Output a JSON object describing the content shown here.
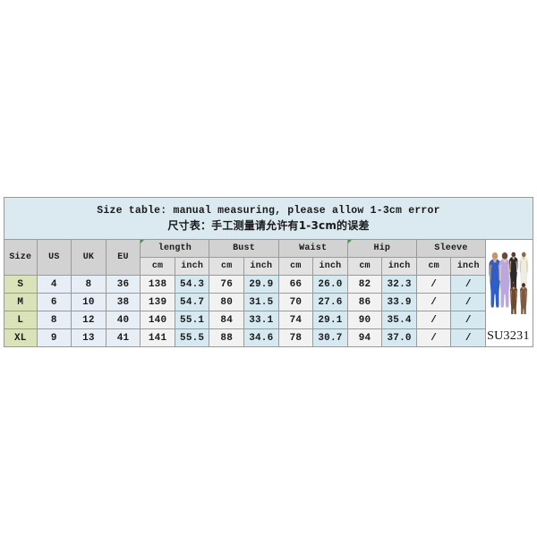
{
  "table": {
    "title_en": "Size table: manual measuring, please allow 1-3cm error",
    "title_cn": "尺寸表：手工测量请允许有1-3cm的误差",
    "base_headers": [
      "Size",
      "US",
      "UK",
      "EU"
    ],
    "measure_groups": [
      "length",
      "Bust",
      "Waist",
      "Hip",
      "Sleeve"
    ],
    "unit_headers": [
      "cm",
      "inch"
    ],
    "rows": [
      {
        "size": "S",
        "us": "4",
        "uk": "8",
        "eu": "36",
        "length_cm": "138",
        "length_inch": "54.3",
        "bust_cm": "76",
        "bust_inch": "29.9",
        "waist_cm": "66",
        "waist_inch": "26.0",
        "hip_cm": "82",
        "hip_inch": "32.3",
        "sleeve_cm": "/",
        "sleeve_inch": "/"
      },
      {
        "size": "M",
        "us": "6",
        "uk": "10",
        "eu": "38",
        "length_cm": "139",
        "length_inch": "54.7",
        "bust_cm": "80",
        "bust_inch": "31.5",
        "waist_cm": "70",
        "waist_inch": "27.6",
        "hip_cm": "86",
        "hip_inch": "33.9",
        "sleeve_cm": "/",
        "sleeve_inch": "/"
      },
      {
        "size": "L",
        "us": "8",
        "uk": "12",
        "eu": "40",
        "length_cm": "140",
        "length_inch": "55.1",
        "bust_cm": "84",
        "bust_inch": "33.1",
        "waist_cm": "74",
        "waist_inch": "29.1",
        "hip_cm": "90",
        "hip_inch": "35.4",
        "sleeve_cm": "/",
        "sleeve_inch": "/"
      },
      {
        "size": "XL",
        "us": "9",
        "uk": "13",
        "eu": "41",
        "length_cm": "141",
        "length_inch": "55.5",
        "bust_cm": "88",
        "bust_inch": "34.6",
        "waist_cm": "78",
        "waist_inch": "30.7",
        "hip_cm": "94",
        "hip_inch": "37.0",
        "sleeve_cm": "/",
        "sleeve_inch": "/"
      }
    ]
  },
  "product": {
    "sku": "SU3231",
    "image_name": "jumpsuit-colorways-thumbnail",
    "colorways": [
      "#2f5fc4",
      "#b9a7e0",
      "#2b2b2b",
      "#efece4",
      "#6a4a33"
    ]
  },
  "colors": {
    "title_background": "#dbeaf0",
    "header_background": "#d2d2d2",
    "subheader_background": "#e2e2e2",
    "size_column_background": "#d9e2b8",
    "standard_column_background": "#e8eef5",
    "cm_column_background": "#f2f2f2",
    "inch_column_background": "#d7e9f0",
    "border": "#9a9a9a",
    "text": "#1a1a1a",
    "marker_green": "#3c9a3c"
  }
}
